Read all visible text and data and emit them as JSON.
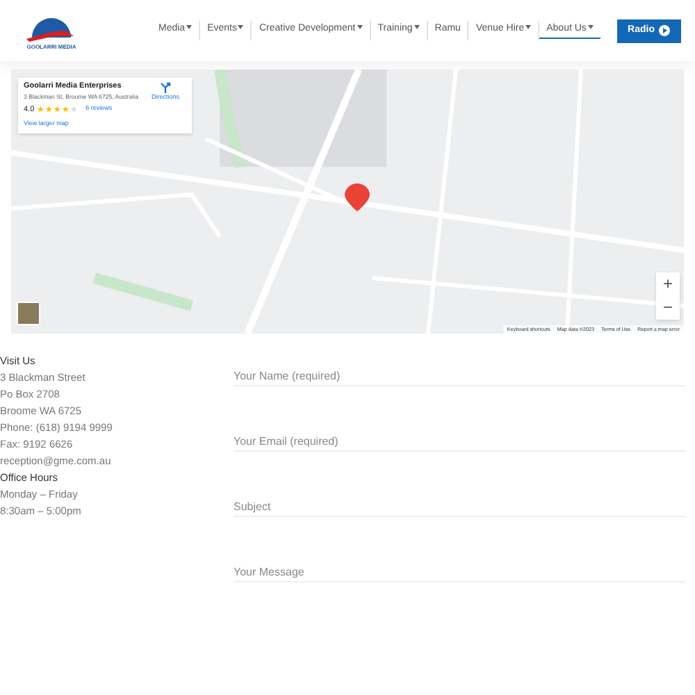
{
  "header": {
    "logo_text": "GOOLARRI MEDIA",
    "nav": [
      {
        "label": "Media",
        "dropdown": true,
        "selected": false
      },
      {
        "label": "Events",
        "dropdown": true,
        "selected": false
      },
      {
        "label": "Creative Development",
        "dropdown": true,
        "selected": false
      },
      {
        "label": "Training",
        "dropdown": true,
        "selected": false
      },
      {
        "label": "Ramu",
        "dropdown": false,
        "selected": false
      },
      {
        "label": "Venue Hire",
        "dropdown": true,
        "selected": false
      },
      {
        "label": "About Us",
        "dropdown": true,
        "selected": true
      }
    ],
    "radio_button": {
      "label": "Radio",
      "primary": true
    }
  },
  "map": {
    "kind": "picture",
    "place_card": {
      "name": "Goolarri Media Enterprises",
      "address": "3 Blackman St, Broome WA 6725, Australia",
      "rating": "4.0",
      "stars": 4,
      "reviews": "6 reviews",
      "directions": "Directions",
      "larger_map": "View larger map"
    },
    "zoom_in": "+",
    "zoom_out": "−",
    "attribution": [
      "Keyboard shortcuts",
      "Map data ©2023",
      "Terms of Use",
      "Report a map error"
    ]
  },
  "contact": {
    "visit_heading": "Visit Us",
    "address_lines": [
      "3 Blackman Street",
      "Po Box 2708",
      "Broome WA 6725",
      "Phone: (618) 9194 9999",
      "Fax: 9192 6626",
      "reception@gme.com.au"
    ],
    "hours_heading": "Office Hours",
    "hours_lines": [
      "Monday – Friday",
      "8:30am – 5:00pm"
    ]
  },
  "form": {
    "fields": [
      {
        "placeholder": "Your Name (required)"
      },
      {
        "placeholder": "Your Email (required)"
      },
      {
        "placeholder": "Subject"
      },
      {
        "placeholder": "Your Message"
      }
    ]
  }
}
